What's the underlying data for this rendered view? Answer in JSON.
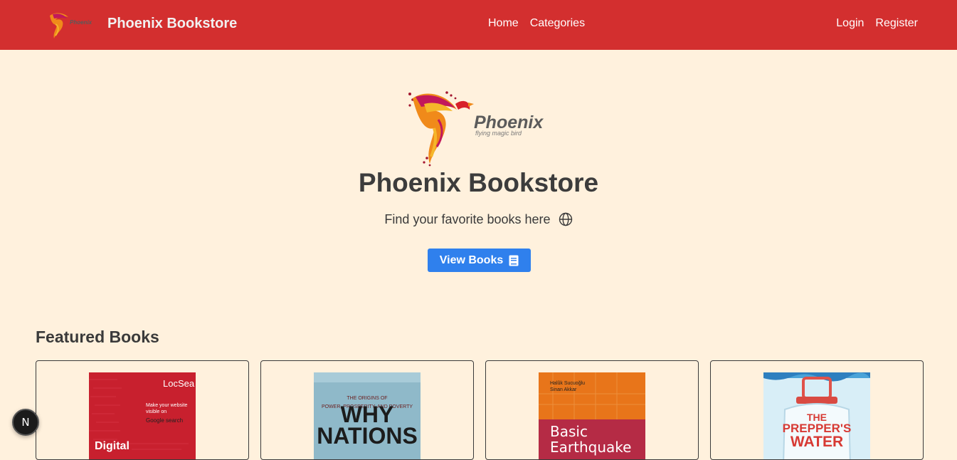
{
  "navbar": {
    "brand": "Phoenix Bookstore",
    "logo_text": "Phoenix",
    "center_links": [
      "Home",
      "Categories"
    ],
    "right_links": [
      "Login",
      "Register"
    ]
  },
  "hero": {
    "logo_title": "Phoenix",
    "logo_tagline": "flying magic bird",
    "title": "Phoenix Bookstore",
    "subtitle": "Find your favorite books here",
    "button_label": "View Books"
  },
  "featured": {
    "title": "Featured Books",
    "books": [
      {
        "cover_lines": [
          "LocSea",
          "Make your website",
          "visible on",
          "Google search",
          "Digital"
        ],
        "cover_color": "#c8202e"
      },
      {
        "cover_lines": [
          "THE ORIGINS OF",
          "POWER, PROSPERITY, AND POVERTY",
          "WHY",
          "NATIONS"
        ],
        "cover_color": "#8fb9c9"
      },
      {
        "cover_lines": [
          "Halûk Sucuoğlu",
          "Sinan Akkar",
          "Basic",
          "Earthquake"
        ],
        "cover_color": "#e8751a"
      },
      {
        "cover_lines": [
          "THE",
          "PREPPER'S",
          "WATER"
        ],
        "cover_color": "#d8eef7"
      }
    ]
  },
  "fab": {
    "label": "N"
  },
  "colors": {
    "navbar": "#d32f2f",
    "background": "#fff1dd",
    "button": "#2f80ed"
  }
}
